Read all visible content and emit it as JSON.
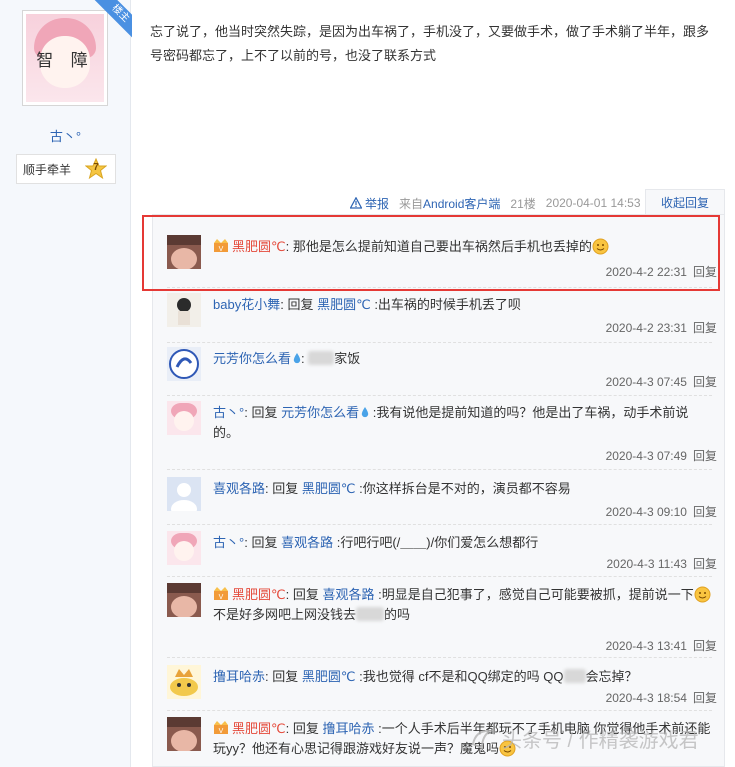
{
  "author": {
    "avatar_text": "智 障",
    "badge": "楼主",
    "name": "古丶°",
    "medal_label": "顺手牵羊",
    "medal_level": "7"
  },
  "post": {
    "text": "忘了说了，他当时突然失踪，是因为出车祸了，手机没了，又要做手术，做了手术躺了半年，跟多号密码都忘了，上不了以前的号，也没了联系方式",
    "report": "举报",
    "source_prefix": "来自",
    "source_client": "Android客户端",
    "floor": "21楼",
    "time": "2020-04-01 14:53",
    "collapse": "收起回复"
  },
  "reply_word": "回复",
  "replies": [
    {
      "user": "黑肥圆℃",
      "text": "那他是怎么提前知道自己要出车祸然后手机也丢掉的",
      "time": "2020-4-2 22:31"
    },
    {
      "user": "baby花小舞",
      "prefix": "回复",
      "target": "黑肥圆℃",
      "text": ":出车祸的时候手机丢了呗",
      "time": "2020-4-2 23:31"
    },
    {
      "user": "元芳你怎么看",
      "text_after": "家饭",
      "time": "2020-4-3 07:45"
    },
    {
      "user": "古丶°",
      "prefix": "回复",
      "target": "元芳你怎么看",
      "text": ":我有说他是提前知道的吗？他是出了车祸，动手术前说的。",
      "time": "2020-4-3 07:49"
    },
    {
      "user": "喜观各路",
      "prefix": "回复",
      "target": "黑肥圆℃",
      "text": ":你这样拆台是不对的，演员都不容易",
      "time": "2020-4-3 09:10"
    },
    {
      "user": "古丶°",
      "prefix": "回复",
      "target": "喜观各路",
      "text": ":行吧行吧(/＿＿)/你们爱怎么想都行",
      "time": "2020-4-3 11:43"
    },
    {
      "user": "黑肥圆℃",
      "prefix": "回复",
      "target": "喜观各路",
      "text_a": ":明显是自己犯事了，感觉自己可能要被抓，提前说一下",
      "text_b": "不是好多网吧上网没钱去",
      "text_c": "的吗",
      "time": "2020-4-3 13:41"
    },
    {
      "user": "撸耳哈赤",
      "prefix": "回复",
      "target": "黑肥圆℃",
      "text_a": ":我也觉得 cf不是和QQ绑定的吗 QQ",
      "text_b": "会忘掉？",
      "time": "2020-4-3 18:54"
    },
    {
      "user": "黑肥圆℃",
      "prefix": "回复",
      "target": "撸耳哈赤",
      "text_a": ":一个人手术后半年都玩不了手机电脑 你觉得他手术前还能玩yy？他还有心思记得跟游戏好友说一声？魔鬼吗",
      "time": ""
    }
  ],
  "watermark": "头条号 / 作精袭游戏君",
  "colors": {
    "link": "#2d64b3",
    "vip_name": "#e54b3c",
    "highlight": "#e53935",
    "panel_bg": "#f7f8fa"
  }
}
